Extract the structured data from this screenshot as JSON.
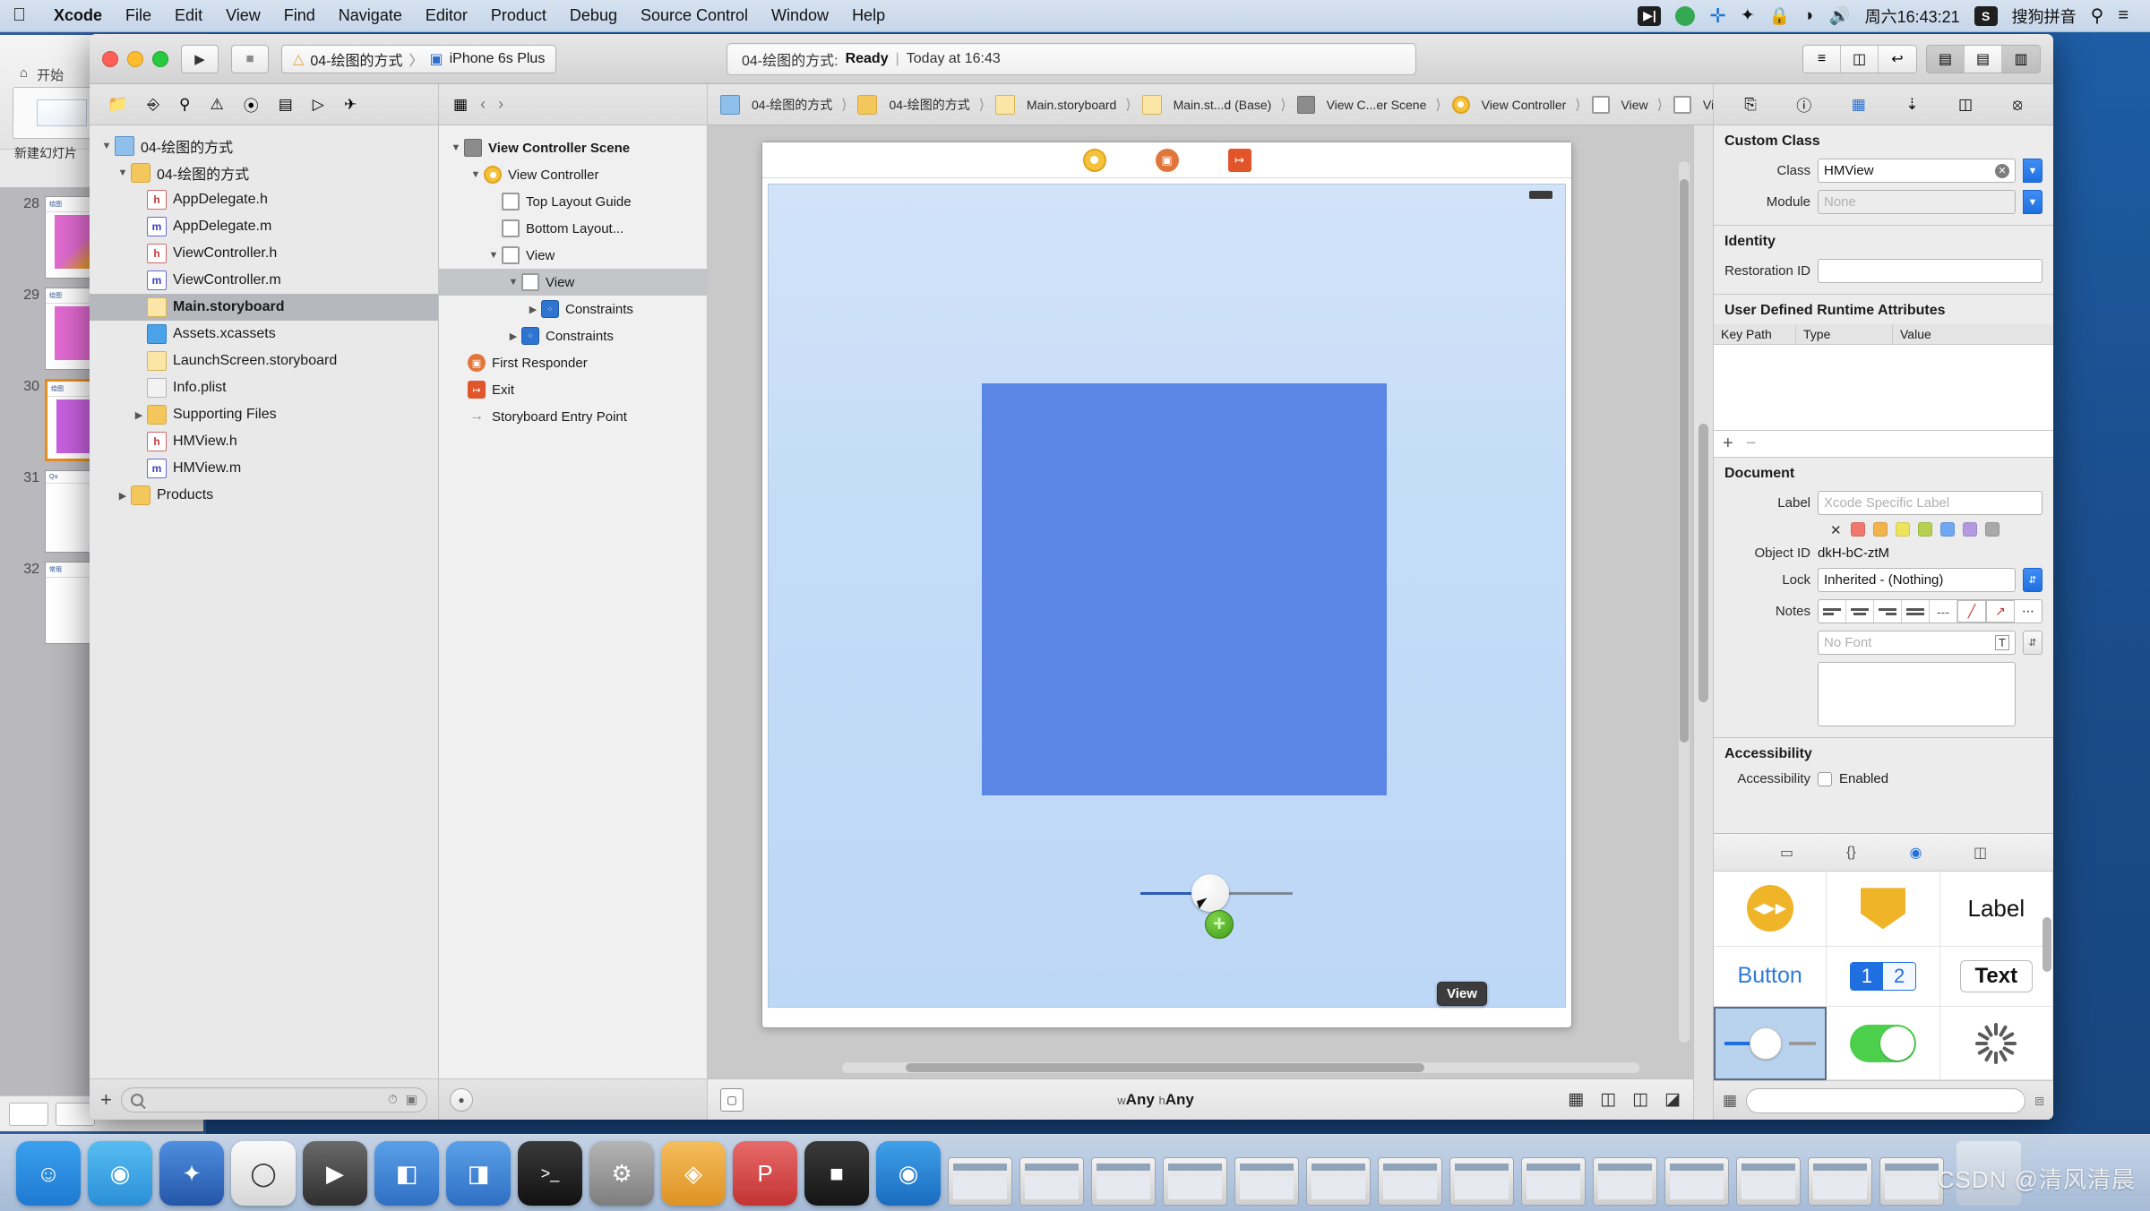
{
  "menubar": {
    "apple_icon": "apple-logo",
    "items": [
      {
        "label": "Xcode",
        "bold": true
      },
      {
        "label": "File"
      },
      {
        "label": "Edit"
      },
      {
        "label": "View"
      },
      {
        "label": "Find"
      },
      {
        "label": "Navigate"
      },
      {
        "label": "Editor"
      },
      {
        "label": "Product"
      },
      {
        "label": "Debug"
      },
      {
        "label": "Source Control"
      },
      {
        "label": "Window"
      },
      {
        "label": "Help"
      }
    ],
    "status": {
      "screen_record": "screen-record-icon",
      "green_dot": "green-status-icon",
      "plus": "plus-icon",
      "bluetooth": "bluetooth-icon",
      "lock": "lock-icon",
      "wifi": "wifi-icon",
      "volume": "volume-icon",
      "clock": "周六16:43:21",
      "ime_badge": "S",
      "ime_label": "搜狗拼音",
      "search": "search-icon",
      "control_center": "list-icon"
    }
  },
  "background_app": {
    "ribbon_tabs": [
      "开始"
    ],
    "new_slide_label": "新建幻灯片",
    "slides": [
      {
        "number": "28"
      },
      {
        "number": "29"
      },
      {
        "number": "30"
      },
      {
        "number": "31"
      },
      {
        "number": "32"
      }
    ]
  },
  "toolbar": {
    "run_icon": "run-play-icon",
    "stop_icon": "stop-square-icon",
    "scheme_icon": "xcode-scheme-icon",
    "scheme_name": "04-绘图的方式",
    "scheme_sep": "〉",
    "device_icon": "iphone-device-icon",
    "device_name": "iPhone 6s Plus",
    "activity_project": "04-绘图的方式:",
    "activity_status": "Ready",
    "activity_sep": "|",
    "activity_time": "Today at 16:43",
    "editor_segment": [
      {
        "name": "standard-editor",
        "icon": "≡",
        "active": false
      },
      {
        "name": "assistant-editor",
        "icon": "◫",
        "active": false
      },
      {
        "name": "version-editor",
        "icon": "↩",
        "active": false
      }
    ],
    "view_segment": [
      {
        "name": "toggle-navigator",
        "icon": "▤",
        "active": true
      },
      {
        "name": "toggle-debug-area",
        "icon": "▤",
        "active": false
      },
      {
        "name": "toggle-inspector",
        "icon": "▥",
        "active": true
      }
    ]
  },
  "navigator_toolbar": {
    "icons": [
      "folder-icon",
      "source-control-icon",
      "search-icon",
      "warning-icon",
      "test-icon",
      "debug-icon",
      "breakpoint-icon",
      "report-icon"
    ]
  },
  "navigator": {
    "items": [
      {
        "label": "04-绘图的方式",
        "indent": 0,
        "twisty": "▼",
        "icon": "proj",
        "glyph": "",
        "selected": false
      },
      {
        "label": "04-绘图的方式",
        "indent": 1,
        "twisty": "▼",
        "icon": "folder",
        "glyph": "",
        "selected": false
      },
      {
        "label": "AppDelegate.h",
        "indent": 2,
        "twisty": "",
        "icon": "h",
        "glyph": "h",
        "selected": false
      },
      {
        "label": "AppDelegate.m",
        "indent": 2,
        "twisty": "",
        "icon": "m",
        "glyph": "m",
        "selected": false
      },
      {
        "label": "ViewController.h",
        "indent": 2,
        "twisty": "",
        "icon": "h",
        "glyph": "h",
        "selected": false
      },
      {
        "label": "ViewController.m",
        "indent": 2,
        "twisty": "",
        "icon": "m",
        "glyph": "m",
        "selected": false
      },
      {
        "label": "Main.storyboard",
        "indent": 2,
        "twisty": "",
        "icon": "sb",
        "glyph": "",
        "selected": true
      },
      {
        "label": "Assets.xcassets",
        "indent": 2,
        "twisty": "",
        "icon": "assets",
        "glyph": "",
        "selected": false
      },
      {
        "label": "LaunchScreen.storyboard",
        "indent": 2,
        "twisty": "",
        "icon": "sb",
        "glyph": "",
        "selected": false
      },
      {
        "label": "Info.plist",
        "indent": 2,
        "twisty": "",
        "icon": "plist",
        "glyph": "",
        "selected": false
      },
      {
        "label": "Supporting Files",
        "indent": 2,
        "twisty": "▶",
        "icon": "folder",
        "glyph": "",
        "selected": false
      },
      {
        "label": "HMView.h",
        "indent": 2,
        "twisty": "",
        "icon": "h",
        "glyph": "h",
        "selected": false
      },
      {
        "label": "HMView.m",
        "indent": 2,
        "twisty": "",
        "icon": "m",
        "glyph": "m",
        "selected": false
      },
      {
        "label": "Products",
        "indent": 1,
        "twisty": "▶",
        "icon": "folder",
        "glyph": "",
        "selected": false
      }
    ],
    "footer": {
      "add_label": "+",
      "filter_placeholder": "",
      "recent_icon": "clock-icon",
      "unsaved_icon": "source-control-icon"
    }
  },
  "outline": {
    "items": [
      {
        "label": "View Controller Scene",
        "indent": 0,
        "twisty": "▼",
        "icon": "scene",
        "bold": true,
        "selected": false
      },
      {
        "label": "View Controller",
        "indent": 1,
        "twisty": "▼",
        "icon": "vc",
        "bold": false,
        "selected": false
      },
      {
        "label": "Top Layout Guide",
        "indent": 2,
        "twisty": "",
        "icon": "guide",
        "bold": false,
        "selected": false
      },
      {
        "label": "Bottom Layout...",
        "indent": 2,
        "twisty": "",
        "icon": "guide",
        "bold": false,
        "selected": false
      },
      {
        "label": "View",
        "indent": 2,
        "twisty": "▼",
        "icon": "view",
        "bold": false,
        "selected": false
      },
      {
        "label": "View",
        "indent": 3,
        "twisty": "▼",
        "icon": "view",
        "bold": false,
        "selected": true
      },
      {
        "label": "Constraints",
        "indent": 4,
        "twisty": "▶",
        "icon": "cons",
        "bold": false,
        "selected": false
      },
      {
        "label": "Constraints",
        "indent": 3,
        "twisty": "▶",
        "icon": "cons",
        "bold": false,
        "selected": false
      },
      {
        "label": "First Responder",
        "indent": 1,
        "twisty": "",
        "icon": "fr",
        "bold": false,
        "selected": false
      },
      {
        "label": "Exit",
        "indent": 1,
        "twisty": "",
        "icon": "exit",
        "bold": false,
        "selected": false
      },
      {
        "label": "Storyboard Entry Point",
        "indent": 1,
        "twisty": "",
        "icon": "arrow",
        "bold": false,
        "selected": false
      }
    ]
  },
  "jump_bar": {
    "back": "‹",
    "forward": "›",
    "grid_icon": "related-items-icon",
    "crumbs": [
      {
        "label": "04-绘图的方式",
        "icon": "proj"
      },
      {
        "label": "04-绘图的方式",
        "icon": "folder"
      },
      {
        "label": "Main.storyboard",
        "icon": "sb"
      },
      {
        "label": "Main.st...d (Base)",
        "icon": "sb"
      },
      {
        "label": "View C...er Scene",
        "icon": "scene"
      },
      {
        "label": "View Controller",
        "icon": "vc"
      },
      {
        "label": "View",
        "icon": "view"
      },
      {
        "label": "View",
        "icon": "view"
      }
    ]
  },
  "canvas": {
    "scene_dock": [
      {
        "name": "view-controller-dock-icon"
      },
      {
        "name": "first-responder-dock-icon"
      },
      {
        "name": "exit-dock-icon"
      }
    ],
    "tooltip": "View",
    "dragging_object": "slider"
  },
  "canvas_footer": {
    "left_icon": "device-orientation-icon",
    "size_class_w_prefix": "w",
    "size_class_w": "Any",
    "size_class_h_prefix": "h",
    "size_class_h": "Any",
    "icons": [
      "auto-layout-icon",
      "align-icon",
      "pin-icon",
      "resolve-issues-icon"
    ]
  },
  "inspector_toolbar": {
    "tabs": [
      "file-inspector-icon",
      "quick-help-icon",
      "identity-inspector-icon",
      "attributes-inspector-icon",
      "size-inspector-icon",
      "connections-inspector-icon"
    ]
  },
  "inspector": {
    "custom_class": {
      "title": "Custom Class",
      "class_label": "Class",
      "class_value": "HMView",
      "module_label": "Module",
      "module_placeholder": "None"
    },
    "identity": {
      "title": "Identity",
      "restoration_label": "Restoration ID",
      "restoration_value": ""
    },
    "runtime_attributes": {
      "title": "User Defined Runtime Attributes",
      "columns": [
        "Key Path",
        "Type",
        "Value"
      ],
      "rows": [],
      "add": "+",
      "remove": "−"
    },
    "document": {
      "title": "Document",
      "label_label": "Label",
      "label_placeholder": "Xcode Specific Label",
      "swatch_colors": [
        "#f0776c",
        "#f2b34a",
        "#eee35c",
        "#b7d04f",
        "#6fa8f0",
        "#b39ae0",
        "#a9a9a9"
      ],
      "object_id_label": "Object ID",
      "object_id_value": "dkH-bC-ztM",
      "lock_label": "Lock",
      "lock_value": "Inherited - (Nothing)",
      "notes_label": "Notes",
      "font_placeholder": "No Font",
      "notes_value": ""
    },
    "accessibility": {
      "title": "Accessibility",
      "label": "Accessibility",
      "enabled_label": "Enabled",
      "enabled_checked": false
    }
  },
  "library": {
    "tabs": [
      {
        "name": "file-template-library",
        "icon": "▭",
        "active": false
      },
      {
        "name": "code-snippet-library",
        "icon": "{}",
        "active": false
      },
      {
        "name": "object-library",
        "icon": "◉",
        "active": true
      },
      {
        "name": "media-library",
        "icon": "◫",
        "active": false
      }
    ],
    "objects": [
      {
        "name": "video-player-object",
        "kind": "pac",
        "label": ""
      },
      {
        "name": "scene-kit-object",
        "kind": "box",
        "label": ""
      },
      {
        "name": "label-object",
        "kind": "label",
        "label": "Label"
      },
      {
        "name": "button-object",
        "kind": "button",
        "label": "Button"
      },
      {
        "name": "segmented-control-object",
        "kind": "segment",
        "label_a": "1",
        "label_b": "2"
      },
      {
        "name": "text-field-object",
        "kind": "text",
        "label": "Text"
      },
      {
        "name": "slider-object",
        "kind": "slider",
        "label": "",
        "selected": true
      },
      {
        "name": "switch-object",
        "kind": "switch",
        "label": ""
      },
      {
        "name": "activity-indicator-object",
        "kind": "spinner",
        "label": ""
      }
    ],
    "footer": {
      "filter_placeholder": "",
      "search_icon": "search-icon",
      "layout_icon": "grid-layout-icon"
    }
  },
  "dock": {
    "apps": [
      {
        "name": "finder",
        "color": "#2d8ce8",
        "glyph": "☺"
      },
      {
        "name": "safari",
        "color": "#2da2e8",
        "glyph": "◎"
      },
      {
        "name": "xcode",
        "color": "#2c6fd1",
        "glyph": "✦"
      },
      {
        "name": "mouse-app",
        "color": "#f2f2f2",
        "glyph": "🖱"
      },
      {
        "name": "video-app",
        "color": "#4a4a4a",
        "glyph": "▶"
      },
      {
        "name": "sketch-like",
        "color": "#e8a33d",
        "glyph": "◆"
      },
      {
        "name": "blue-app-1",
        "color": "#3d7fd1",
        "glyph": "◧"
      },
      {
        "name": "blue-app-2",
        "color": "#3d7fd1",
        "glyph": "◨"
      },
      {
        "name": "terminal",
        "color": "#1c1c1c",
        "glyph": ">_"
      },
      {
        "name": "system-preferences",
        "color": "#8a8a8a",
        "glyph": "⚙"
      },
      {
        "name": "sketch",
        "color": "#f0a83a",
        "glyph": "◈"
      },
      {
        "name": "prototype-app",
        "color": "#d94f4f",
        "glyph": "P"
      },
      {
        "name": "dark-app",
        "color": "#2a2a2a",
        "glyph": "■"
      },
      {
        "name": "media-app",
        "color": "#1b7fd1",
        "glyph": "◉"
      }
    ],
    "windows_count": 14,
    "trash": "trash-icon"
  },
  "watermark": "CSDN @清风清晨"
}
